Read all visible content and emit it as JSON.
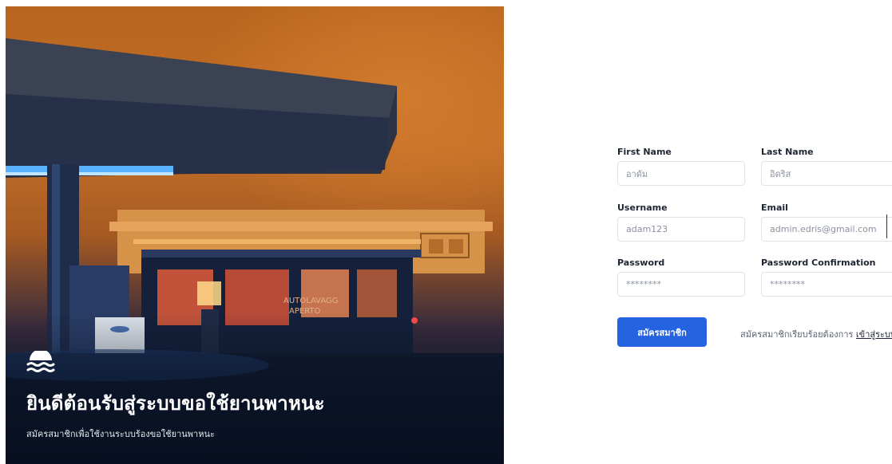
{
  "hero": {
    "title": "ยินดีต้อนรับสู่ระบบขอใช้ยานพาหนะ",
    "subtitle": "สมัครสมาชิกเพื่อใช้งานระบบร้องขอใช้ยานพาหนะ",
    "sign_text_1": "AUTOLAVAGG",
    "sign_text_2": "APERTO"
  },
  "form": {
    "first_name": {
      "label": "First Name",
      "value": "อาดัม"
    },
    "last_name": {
      "label": "Last Name",
      "value": "อิดริส"
    },
    "username": {
      "label": "Username",
      "value": "adam123"
    },
    "email": {
      "label": "Email",
      "value": "admin.edris@gmail.com"
    },
    "password": {
      "label": "Password",
      "value": "********"
    },
    "password_confirmation": {
      "label": "Password Confirmation",
      "value": "********"
    },
    "submit_label": "สมัครสมาชิก",
    "login_prompt": "สมัครสมาชิกเรียบร้อยต้องการ",
    "login_link": "เข้าสู่ระบบ"
  },
  "colors": {
    "primary": "#2563e0",
    "text_dark": "#1e2533",
    "border": "#dfe3ea"
  },
  "icons": {
    "brand": "water-waves-icon"
  }
}
